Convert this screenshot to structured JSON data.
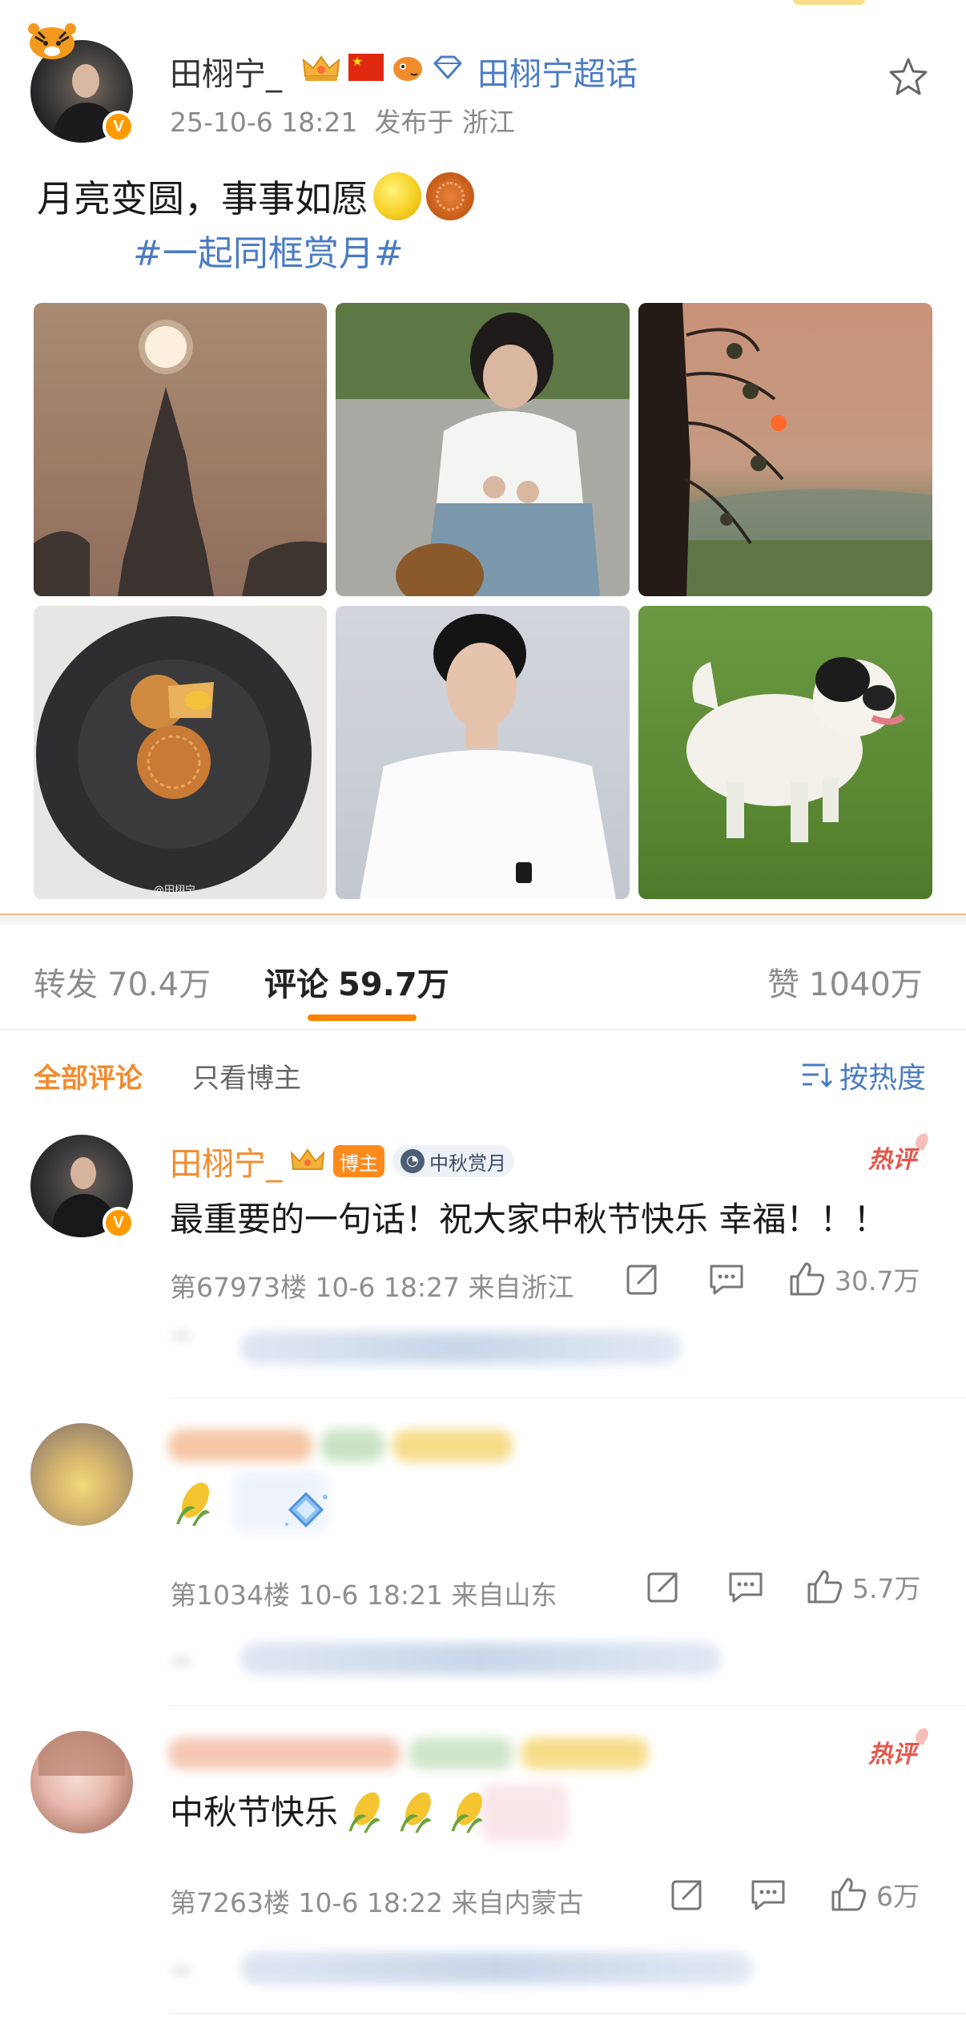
{
  "post": {
    "author": "田栩宁_",
    "super_topic": "田栩宁超话",
    "timestamp": "25-10-6 18:21",
    "location": "发布于 浙江",
    "text": "月亮变圆，事事如愿",
    "hashtag": "#一起同框赏月#",
    "photo_watermark": "@田栩宁",
    "photos": [
      "sunset-tree",
      "sitting-with-dog",
      "sunset-field",
      "mooncakes-plate",
      "portrait-white-tee",
      "puppy-on-grass"
    ]
  },
  "stats": {
    "repost_label": "转发",
    "repost_count": "70.4万",
    "comment_label": "评论",
    "comment_count": "59.7万",
    "like_label": "赞",
    "like_count": "1040万"
  },
  "filters": {
    "all": "全部评论",
    "owner_only": "只看博主",
    "sort": "按热度"
  },
  "comments": [
    {
      "name": "田栩宁_",
      "role_tag": "博主",
      "event_tag": "中秋赏月",
      "hot_badge": "热评",
      "text": "最重要的一句话！祝大家中秋节快乐 幸福！！！",
      "floor": "第67973楼",
      "time": "10-6 18:27",
      "from": "来自浙江",
      "likes": "30.7万"
    },
    {
      "floor": "第1034楼",
      "time": "10-6 18:21",
      "from": "来自山东",
      "likes": "5.7万"
    },
    {
      "hot_badge": "热评",
      "text": "中秋节快乐",
      "floor": "第7263楼",
      "time": "10-6 18:22",
      "from": "来自内蒙古",
      "likes": "6万"
    }
  ],
  "colors": {
    "accent_orange": "#ff8200",
    "link_blue": "#4a7cc3",
    "hot_red": "#e3574c"
  }
}
